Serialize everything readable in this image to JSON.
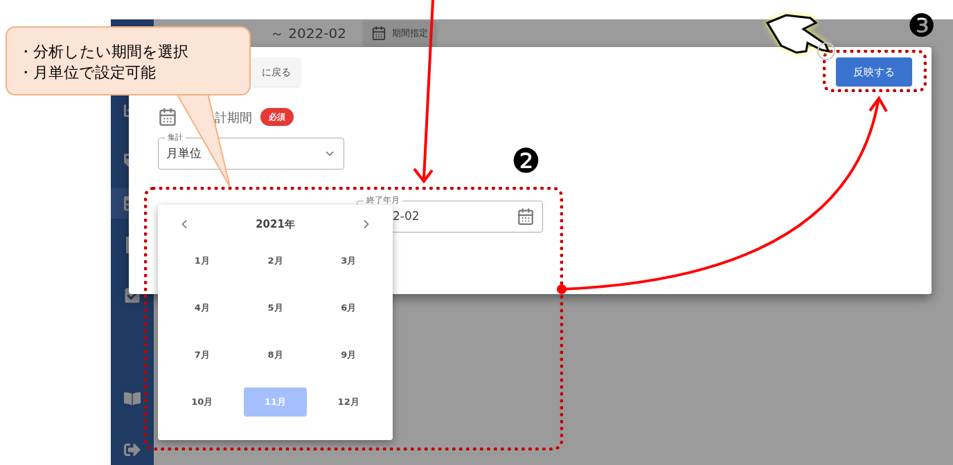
{
  "top_bar": {
    "period": "～ 2022-02",
    "period_button": "期間指定"
  },
  "sidebar": {
    "items": [
      {
        "kind": "chart",
        "selected": false
      },
      {
        "kind": "tag",
        "selected": false
      },
      {
        "kind": "table",
        "selected": true
      },
      {
        "kind": "file",
        "selected": false
      },
      {
        "kind": "check",
        "selected": false
      },
      {
        "kind": "book",
        "selected": false
      },
      {
        "kind": "logout",
        "selected": false
      }
    ]
  },
  "dialog": {
    "back_button": "に戻る",
    "apply_button": "反映する",
    "section_title": "計期間",
    "required_badge": "必須",
    "unit_select": {
      "label": "集計",
      "value": "月単位"
    },
    "end_field": {
      "label": "終了年月",
      "value": "2-02"
    }
  },
  "month_picker": {
    "year": "2021年",
    "months": [
      {
        "label": "1月",
        "selected": false
      },
      {
        "label": "2月",
        "selected": false
      },
      {
        "label": "3月",
        "selected": false
      },
      {
        "label": "4月",
        "selected": false
      },
      {
        "label": "5月",
        "selected": false
      },
      {
        "label": "6月",
        "selected": false
      },
      {
        "label": "7月",
        "selected": false
      },
      {
        "label": "8月",
        "selected": false
      },
      {
        "label": "9月",
        "selected": false
      },
      {
        "label": "10月",
        "selected": false
      },
      {
        "label": "11月",
        "selected": true
      },
      {
        "label": "12月",
        "selected": false
      }
    ]
  },
  "annotations": {
    "callout": [
      "・分析したい期間を選択",
      "・月単位で設定可能"
    ],
    "step_2": "❷",
    "step_3": "❸"
  }
}
